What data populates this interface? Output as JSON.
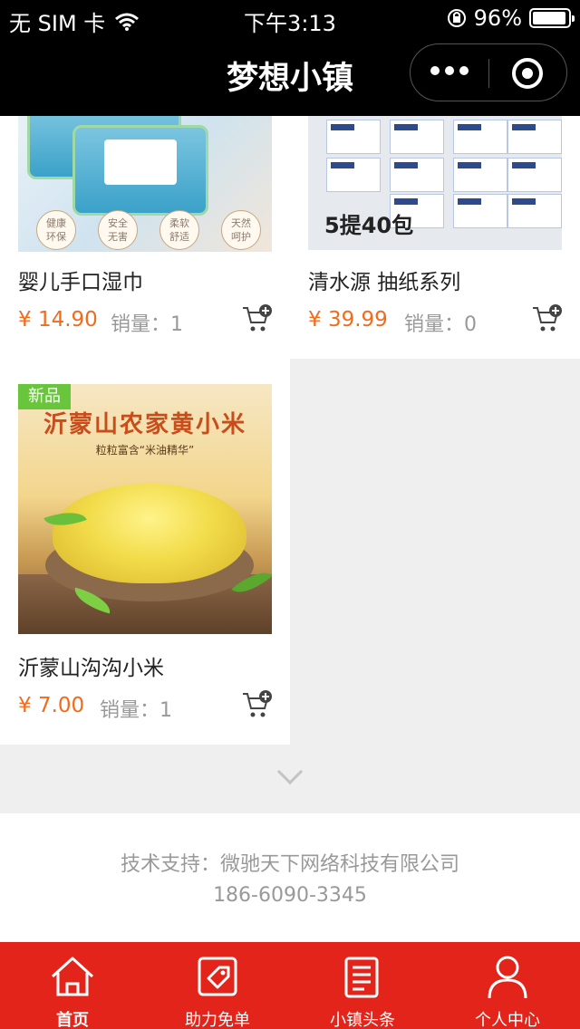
{
  "status_bar": {
    "carrier": "无 SIM 卡",
    "time": "下午3:13",
    "battery": "96%",
    "battery_level": 0.96,
    "icons": [
      "wifi-icon",
      "orientation-lock-icon",
      "battery-icon"
    ]
  },
  "nav": {
    "title": "梦想小镇",
    "icons": [
      "more-icon",
      "close-miniprogram-icon"
    ]
  },
  "products": [
    {
      "name": "婴儿手口湿巾",
      "price": "¥ 14.90",
      "sales": "销量：1",
      "badge": "",
      "image_tags": [
        "健康\n环保",
        "安全\n无害",
        "柔软\n舒适",
        "天然\n呵护"
      ],
      "image_caption": ""
    },
    {
      "name": "清水源 抽纸系列",
      "price": "¥ 39.99",
      "sales": "销量：0",
      "badge": "",
      "image_tags": [],
      "image_caption": "5提40包"
    },
    {
      "name": "沂蒙山沟沟小米",
      "price": "¥ 7.00",
      "sales": "销量：1",
      "badge": "新品",
      "image_tags": [],
      "image_caption": "沂蒙山农家黄小米",
      "image_subcaption": "粒粒富含“米油精华”"
    }
  ],
  "footer": {
    "support": "技术支持：微驰天下网络科技有限公司",
    "phone": "186-6090-3345"
  },
  "tabs": [
    {
      "label": "首页",
      "icon": "home-icon",
      "active": true
    },
    {
      "label": "助力免单",
      "icon": "coupon-tag-icon",
      "active": false
    },
    {
      "label": "小镇头条",
      "icon": "news-document-icon",
      "active": false
    },
    {
      "label": "个人中心",
      "icon": "user-icon",
      "active": false
    }
  ],
  "colors": {
    "price": "#f26b1d",
    "tab_bar": "#e3241b",
    "new_badge": "#69c63c",
    "header": "#000000"
  }
}
